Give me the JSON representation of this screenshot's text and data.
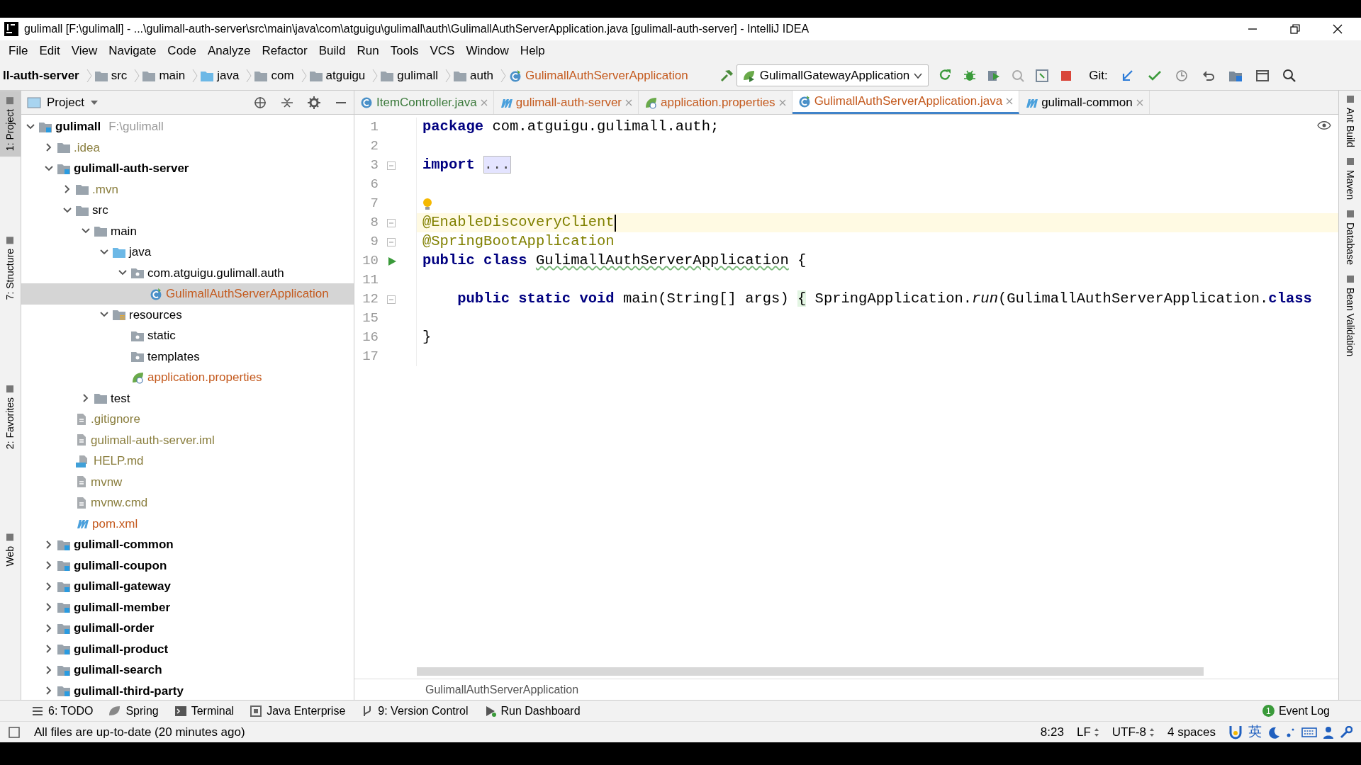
{
  "window": {
    "title": "gulimall [F:\\gulimall] - ...\\gulimall-auth-server\\src\\main\\java\\com\\atguigu\\gulimall\\auth\\GulimallAuthServerApplication.java [gulimall-auth-server] - IntelliJ IDEA"
  },
  "menu": [
    "File",
    "Edit",
    "View",
    "Navigate",
    "Code",
    "Analyze",
    "Refactor",
    "Build",
    "Run",
    "Tools",
    "VCS",
    "Window",
    "Help"
  ],
  "breadcrumbs": [
    {
      "label": "ll-auth-server",
      "kind": "module"
    },
    {
      "label": "src",
      "kind": "folder"
    },
    {
      "label": "main",
      "kind": "folder"
    },
    {
      "label": "java",
      "kind": "source-folder"
    },
    {
      "label": "com",
      "kind": "folder"
    },
    {
      "label": "atguigu",
      "kind": "folder"
    },
    {
      "label": "gulimall",
      "kind": "folder"
    },
    {
      "label": "auth",
      "kind": "folder"
    },
    {
      "label": "GulimallAuthServerApplication",
      "kind": "spring-class"
    }
  ],
  "run_config": "GulimallGatewayApplication",
  "git_label": "Git:",
  "left_stripe": [
    {
      "label": "1: Project",
      "selected": true
    },
    {
      "label": "7: Structure",
      "selected": false
    },
    {
      "label": "2: Favorites",
      "selected": false
    },
    {
      "label": "Web",
      "selected": false
    }
  ],
  "right_stripe": [
    {
      "label": "Ant Build"
    },
    {
      "label": "Maven"
    },
    {
      "label": "Database"
    },
    {
      "label": "Bean Validation"
    }
  ],
  "project_panel": {
    "title": "Project"
  },
  "tree": [
    {
      "label": "gulimall",
      "kind": "module",
      "note": "F:\\gulimall",
      "color": "#000000",
      "expanded": true,
      "selected": false,
      "children": [
        {
          "label": ".idea",
          "kind": "folder",
          "color": "#8a7e3e",
          "expanded": false,
          "selected": false
        },
        {
          "label": "gulimall-auth-server",
          "kind": "module",
          "color": "#000000",
          "expanded": true,
          "selected": false,
          "children": [
            {
              "label": ".mvn",
              "kind": "folder",
              "color": "#8a7e3e",
              "expanded": false,
              "selected": false
            },
            {
              "label": "src",
              "kind": "folder",
              "color": "#000000",
              "expanded": true,
              "selected": false,
              "children": [
                {
                  "label": "main",
                  "kind": "folder",
                  "color": "#000000",
                  "expanded": true,
                  "selected": false,
                  "children": [
                    {
                      "label": "java",
                      "kind": "source-folder",
                      "color": "#000000",
                      "expanded": true,
                      "selected": false,
                      "children": [
                        {
                          "label": "com.atguigu.gulimall.auth",
                          "kind": "package",
                          "color": "#000000",
                          "expanded": true,
                          "selected": false,
                          "children": [
                            {
                              "label": "GulimallAuthServerApplication",
                              "kind": "spring-class",
                              "color": "#c45a1e",
                              "selected": true
                            }
                          ]
                        }
                      ]
                    },
                    {
                      "label": "resources",
                      "kind": "resources",
                      "color": "#000000",
                      "expanded": true,
                      "selected": false,
                      "children": [
                        {
                          "label": "static",
                          "kind": "package",
                          "color": "#000000",
                          "selected": false
                        },
                        {
                          "label": "templates",
                          "kind": "package",
                          "color": "#000000",
                          "selected": false
                        },
                        {
                          "label": "application.properties",
                          "kind": "properties",
                          "color": "#c45a1e",
                          "selected": false
                        }
                      ]
                    }
                  ]
                },
                {
                  "label": "test",
                  "kind": "folder",
                  "color": "#000000",
                  "expanded": false,
                  "selected": false
                }
              ]
            },
            {
              "label": ".gitignore",
              "kind": "file",
              "color": "#8a7e3e",
              "selected": false
            },
            {
              "label": "gulimall-auth-server.iml",
              "kind": "file",
              "color": "#8a7e3e",
              "selected": false
            },
            {
              "label": "HELP.md",
              "kind": "markdown",
              "color": "#8a7e3e",
              "selected": false
            },
            {
              "label": "mvnw",
              "kind": "file",
              "color": "#8a7e3e",
              "selected": false
            },
            {
              "label": "mvnw.cmd",
              "kind": "file",
              "color": "#8a7e3e",
              "selected": false
            },
            {
              "label": "pom.xml",
              "kind": "maven",
              "color": "#c45a1e",
              "selected": false
            }
          ]
        },
        {
          "label": "gulimall-common",
          "kind": "module",
          "color": "#000000",
          "expanded": false,
          "selected": false
        },
        {
          "label": "gulimall-coupon",
          "kind": "module",
          "color": "#000000",
          "expanded": false,
          "selected": false
        },
        {
          "label": "gulimall-gateway",
          "kind": "module",
          "color": "#000000",
          "expanded": false,
          "selected": false
        },
        {
          "label": "gulimall-member",
          "kind": "module",
          "color": "#000000",
          "expanded": false,
          "selected": false
        },
        {
          "label": "gulimall-order",
          "kind": "module",
          "color": "#000000",
          "expanded": false,
          "selected": false
        },
        {
          "label": "gulimall-product",
          "kind": "module",
          "color": "#000000",
          "expanded": false,
          "selected": false
        },
        {
          "label": "gulimall-search",
          "kind": "module",
          "color": "#000000",
          "expanded": false,
          "selected": false
        },
        {
          "label": "gulimall-third-party",
          "kind": "module",
          "color": "#000000",
          "expanded": false,
          "selected": false
        }
      ]
    }
  ],
  "tabs": [
    {
      "label": "ItemController.java",
      "kind": "class",
      "color": "#3c7a3c",
      "selected": false
    },
    {
      "label": "gulimall-auth-server",
      "kind": "maven",
      "color": "#c45a1e",
      "selected": false
    },
    {
      "label": "application.properties",
      "kind": "properties",
      "color": "#c45a1e",
      "selected": false
    },
    {
      "label": "GulimallAuthServerApplication.java",
      "kind": "spring-class",
      "color": "#c45a1e",
      "selected": true
    },
    {
      "label": "gulimall-common",
      "kind": "maven",
      "color": "#000000",
      "selected": false
    }
  ],
  "code": [
    {
      "number": "1",
      "kind": "plain",
      "current": false,
      "tokens": [
        {
          "t": "package",
          "kind": "keyword"
        },
        {
          "t": " com.atguigu.gulimall.auth;",
          "kind": "plain"
        }
      ]
    },
    {
      "number": "2",
      "kind": "plain",
      "current": false
    },
    {
      "number": "3",
      "kind": "fold",
      "current": false,
      "tokens": [
        {
          "t": "import",
          "kind": "keyword"
        },
        {
          "t": "...",
          "kind": "folded"
        }
      ]
    },
    {
      "number": "6",
      "kind": "plain",
      "current": false
    },
    {
      "number": "7",
      "kind": "bulb",
      "current": false
    },
    {
      "number": "8",
      "kind": "fold",
      "current": true,
      "tokens": [
        {
          "t": "@EnableDiscoveryClient",
          "kind": "annotation"
        }
      ]
    },
    {
      "number": "9",
      "kind": "fold",
      "current": false,
      "tokens": [
        {
          "t": "@SpringBootApplication",
          "kind": "annotation"
        }
      ]
    },
    {
      "number": "10",
      "kind": "run",
      "current": false,
      "tokens": [
        {
          "t": "public class ",
          "kind": "keyword"
        },
        {
          "t": "GulimallAuthServerApplication",
          "kind": "typo"
        },
        {
          "t": " {",
          "kind": "plain"
        }
      ]
    },
    {
      "number": "11",
      "kind": "plain",
      "current": false
    },
    {
      "number": "12",
      "kind": "fold",
      "current": false,
      "tokens": [
        {
          "t": "    public static void",
          "kind": "keyword"
        },
        {
          "t": " main(String[] args) ",
          "kind": "plain"
        },
        {
          "t": "{",
          "kind": "brace"
        },
        {
          "t": " SpringApplication.",
          "kind": "plain"
        },
        {
          "t": "run",
          "kind": "static-call"
        },
        {
          "t": "(GulimallAuthServerApplication.",
          "kind": "plain"
        },
        {
          "t": "class",
          "kind": "keyword"
        }
      ]
    },
    {
      "number": "15",
      "kind": "plain",
      "current": false
    },
    {
      "number": "16",
      "kind": "plain",
      "current": false,
      "tokens": [
        {
          "t": "}",
          "kind": "plain"
        }
      ]
    },
    {
      "number": "17",
      "kind": "plain",
      "current": false
    }
  ],
  "editor_breadcrumb": "GulimallAuthServerApplication",
  "tool_windows": [
    {
      "label": "6: TODO",
      "kind": "todo"
    },
    {
      "label": "Spring",
      "kind": "spring"
    },
    {
      "label": "Terminal",
      "kind": "terminal"
    },
    {
      "label": "Java Enterprise",
      "kind": "enterprise"
    },
    {
      "label": "9: Version Control",
      "kind": "vcs"
    },
    {
      "label": "Run Dashboard",
      "kind": "run"
    }
  ],
  "event_log": {
    "label": "Event Log",
    "badge": "1"
  },
  "status_bar": {
    "message": "All files are up-to-date (20 minutes ago)",
    "position": "8:23",
    "line_separator": "LF",
    "encoding": "UTF-8",
    "indent": "4 spaces",
    "ime": "英"
  }
}
